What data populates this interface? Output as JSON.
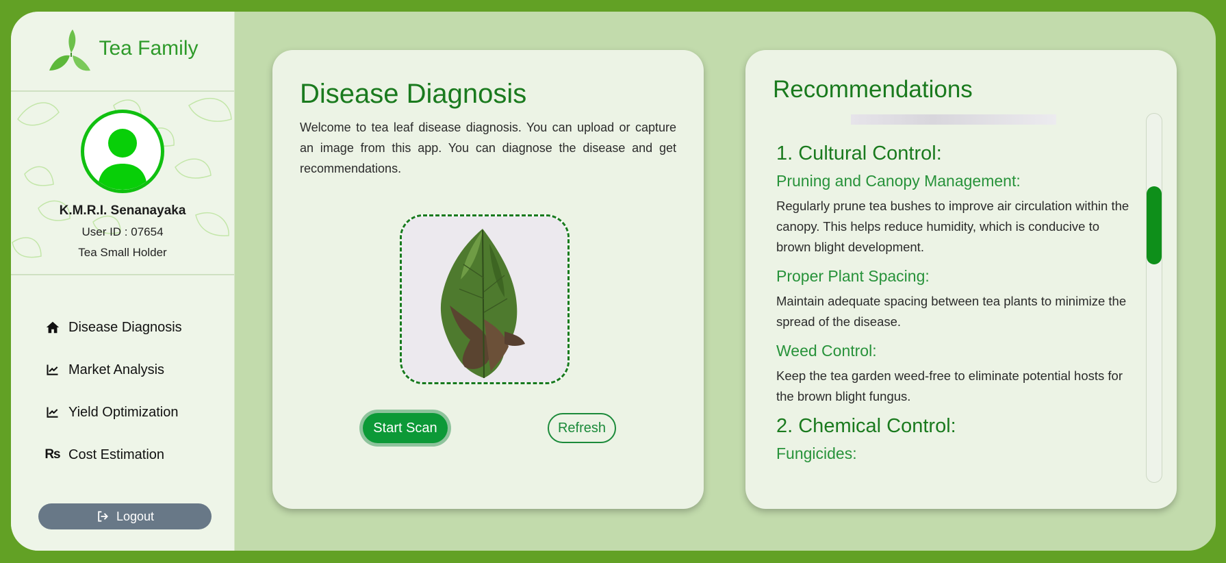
{
  "brand": {
    "name": "Tea Family"
  },
  "user": {
    "name": "K.M.R.I. Senanayaka",
    "id_label": "User ID : 07654",
    "role": "Tea Small Holder"
  },
  "nav": {
    "items": [
      {
        "label": "Disease Diagnosis",
        "icon": "home-icon"
      },
      {
        "label": "Market Analysis",
        "icon": "chart-line-icon"
      },
      {
        "label": "Yield Optimization",
        "icon": "chart-line-icon"
      },
      {
        "label": "Cost Estimation",
        "icon": "rupee-icon"
      }
    ],
    "logout_label": "Logout"
  },
  "diagnosis": {
    "title": "Disease Diagnosis",
    "description": "Welcome to tea leaf disease diagnosis. You can upload or capture an image from this app. You can diagnose the disease and get recommendations.",
    "start_scan_label": "Start Scan",
    "refresh_label": "Refresh"
  },
  "recommendations": {
    "title": "Recommendations",
    "sections": {
      "cultural": {
        "heading": "1. Cultural Control:",
        "pruning_title": "Pruning and Canopy Management:",
        "pruning_text": "Regularly prune tea bushes to improve air circulation within the canopy. This helps reduce humidity, which is conducive to brown blight development.",
        "spacing_title": "Proper Plant Spacing:",
        "spacing_text": "Maintain adequate spacing between tea plants to minimize the spread of the disease.",
        "weed_title": "Weed Control:",
        "weed_text": "Keep the tea garden weed-free to eliminate potential hosts for the brown blight fungus."
      },
      "chemical": {
        "heading": "2. Chemical Control:",
        "fungicides_title": "Fungicides:"
      }
    }
  },
  "colors": {
    "outer_bg": "#62a125",
    "main_bg": "#c2dbac",
    "accent_green": "#1a7a1e",
    "scan_button": "#0c9937",
    "logout_button": "#687887",
    "scroll_thumb": "#0e8f1a"
  }
}
